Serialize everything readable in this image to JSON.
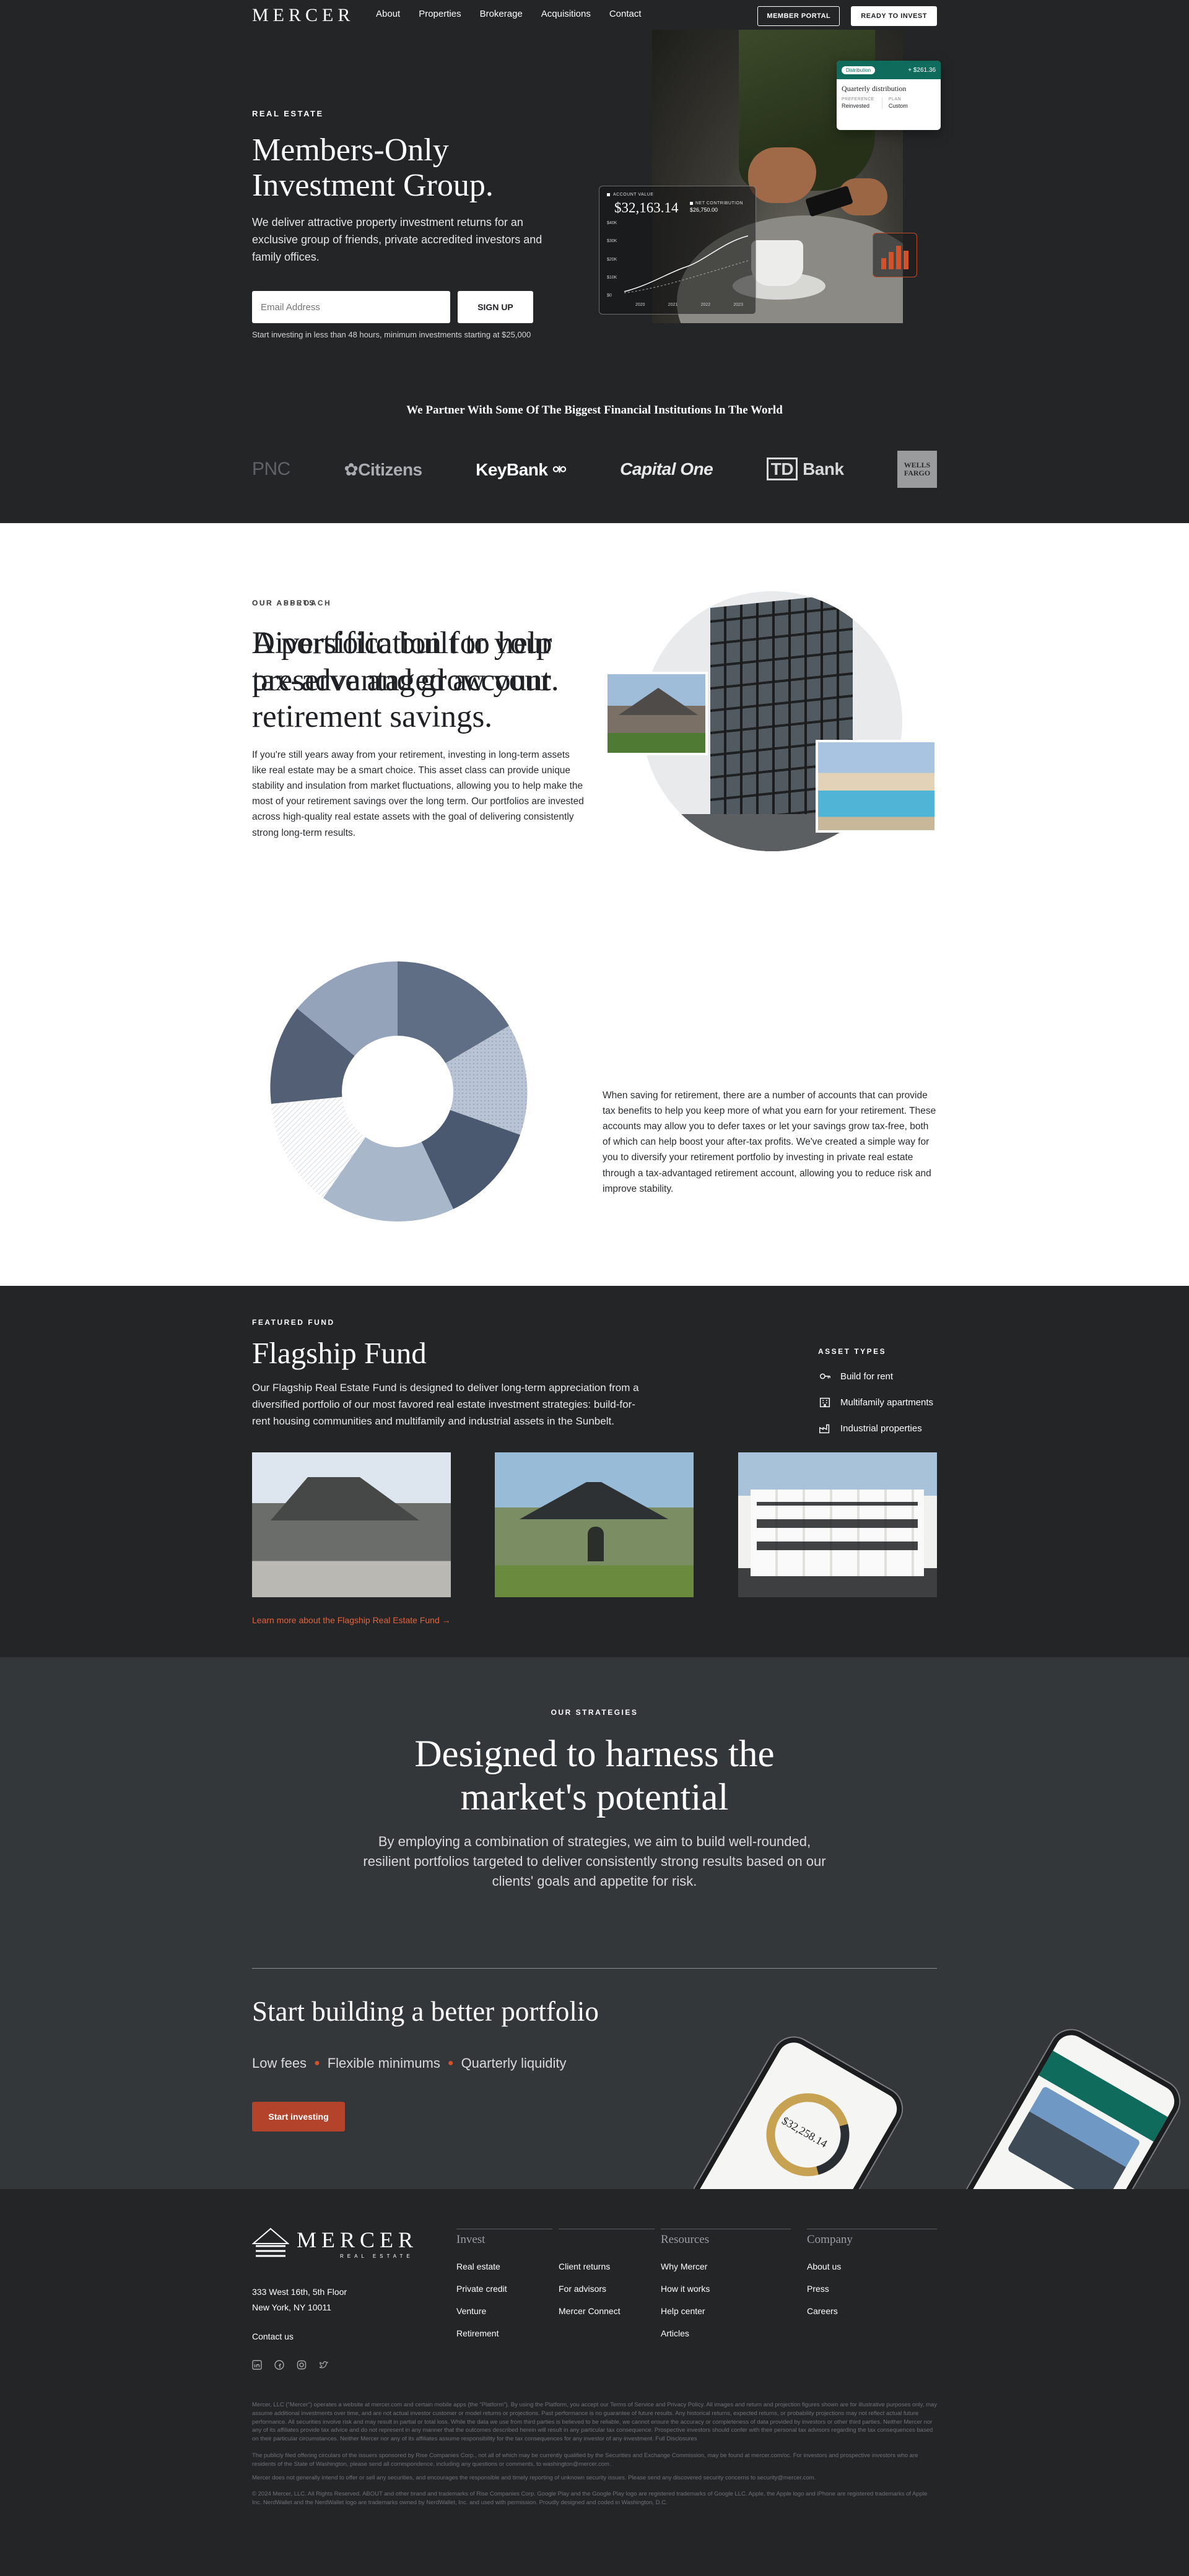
{
  "brand": "MERCER",
  "nav": {
    "links": [
      "About",
      "Properties",
      "Brokerage",
      "Acquisitions",
      "Contact"
    ],
    "member_portal": "MEMBER PORTAL",
    "ready": "READY TO INVEST"
  },
  "hero": {
    "eyebrow": "REAL ESTATE",
    "title": "Members-Only Investment Group.",
    "lead": "We deliver attractive property investment returns for an exclusive group of friends, private accredited investors and family offices.",
    "email_placeholder": "Email Address",
    "signup": "SIGN UP",
    "note": "Start investing in less than 48 hours, minimum investments starting at $25,000"
  },
  "dist_card": {
    "pill": "Distribution",
    "amount": "+ $261.36",
    "title": "Quarterly distribution",
    "k1": "PREFERENCE",
    "v1": "Reinvested",
    "k2": "PLAN",
    "v2": "Custom"
  },
  "acct_card": {
    "label": "ACCOUNT VALUE",
    "value": "$32,163.14",
    "net_label": "NET CONTRIBUTION",
    "net_value": "$26,750.00",
    "y_ticks": [
      "$40K",
      "$30K",
      "$20K",
      "$10K",
      "$0"
    ],
    "x_ticks": [
      "2020",
      "2021",
      "2022",
      "2023"
    ]
  },
  "partners": {
    "title": "We Partner With Some Of The Biggest Financial Institutions In The World",
    "logos": [
      "PNC",
      "Citizens",
      "KeyBank",
      "Capital One",
      "Bank",
      "WELLS FARGO"
    ]
  },
  "assets": {
    "eyebrow": "OUR ASSETS",
    "title": "A portfolio built to help preserve and grow your retirement savings.",
    "body": "If you're still years away from your retirement, investing in long-term assets like real estate may be a smart choice. This asset class can provide unique stability and insulation from market fluctuations, allowing you to help make the most of your retirement savings over the long term. Our portfolios are invested across high-quality real estate assets with the goal of delivering consistently strong long-term results."
  },
  "approach": {
    "eyebrow": "OUR APPROACH",
    "title": "Diversification for your tax-advantaged account.",
    "body": "When saving for retirement, there are a number of accounts that can provide tax benefits to help you keep more of what you earn for your retirement. These accounts may allow you to defer taxes or let your savings grow tax-free, both of which can help boost your after-tax profits. We've created a simple way for you to diversify your retirement portfolio by investing in private real estate through a tax-advantaged retirement account, allowing you to reduce risk and improve stability."
  },
  "flagship": {
    "eyebrow": "FEATURED FUND",
    "title": "Flagship Fund",
    "lead": "Our Flagship Real Estate Fund is designed to deliver long-term appreciation from a diversified portfolio of our most favored real estate investment strategies: build-for-rent housing communities and multifamily and industrial assets in the Sunbelt.",
    "types_title": "ASSET TYPES",
    "types": [
      "Build for rent",
      "Multifamily apartments",
      "Industrial properties"
    ],
    "more": "Learn more about the Flagship Real Estate Fund →"
  },
  "strategies": {
    "eyebrow": "OUR STRATEGIES",
    "title": "Designed to harness the market's potential",
    "lead": "By employing a combination of strategies, we aim to build well-rounded, resilient portfolios targeted to deliver consistently strong results based on our clients' goals and appetite for risk.",
    "build_title": "Start building a better portfolio",
    "features": [
      "Low fees",
      "Flexible minimums",
      "Quarterly liquidity"
    ],
    "cta": "Start investing",
    "phone_amount": "$32,258.14"
  },
  "footer": {
    "logo_sub": "REAL ESTATE",
    "address": [
      "333 West 16th, 5th Floor",
      "New York, NY 10011"
    ],
    "contact": "Contact us",
    "cols": [
      {
        "title": "Invest",
        "links": [
          "Real estate",
          "Private credit",
          "Venture",
          "Retirement"
        ]
      },
      {
        "title": "",
        "links": [
          "Client returns",
          "For advisors",
          "Mercer Connect"
        ]
      },
      {
        "title": "Resources",
        "links": [
          "Why Mercer",
          "How it works",
          "Help center",
          "Articles"
        ]
      },
      {
        "title": "Company",
        "links": [
          "About us",
          "Press",
          "Careers"
        ]
      }
    ],
    "fine1": "Mercer, LLC (\"Mercer\") operates a website at mercer.com and certain mobile apps (the \"Platform\"). By using the Platform, you accept our Terms of Service and Privacy Policy. All images and return and projection figures shown are for illustrative purposes only, may assume additional investments over time, and are not actual investor customer or model returns or projections. Past performance is no guarantee of future results. Any historical returns, expected returns, or probability projections may not reflect actual future performance. All securities involve risk and may result in partial or total loss. While the data we use from third parties is believed to be reliable, we cannot ensure the accuracy or completeness of data provided by investors or other third parties. Neither Mercer nor any of its affiliates provide tax advice and do not represent in any manner that the outcomes described herein will result in any particular tax consequence. Prospective investors should confer with their personal tax advisors regarding the tax consequences based on their particular circumstances. Neither Mercer nor any of its affiliates assume responsibility for the tax consequences for any investor of any investment. Full Disclosures",
    "fine2": "The publicly filed offering circulars of the issuers sponsored by Rise Companies Corp., not all of which may be currently qualified by the Securities and Exchange Commission, may be found at mercer.com/oc. For investors and prospective investors who are residents of the State of Washington, please send all correspondence, including any questions or comments, to washington@mercer.com.",
    "fine3": "Mercer does not generally intend to offer or sell any securities, and encourages the responsible and timely reporting of unknown security issues. Please send any discovered security concerns to security@mercer.com.",
    "fine4": "© 2024 Mercer, LLC. All Rights Reserved. ABOUT and other brand and trademarks of Rise Companies Corp. Google Play and the Google Play logo are registered trademarks of Google LLC. Apple, the Apple logo and iPhone are registered trademarks of Apple Inc. NerdWallet and the NerdWallet logo are trademarks owned by NerdWallet, Inc. and used with permission. Proudly designed and coded in Washington, D.C."
  },
  "colors": {
    "dark": "#232527",
    "dark2": "#34373a",
    "accent": "#b3432a",
    "teal": "#0f6b5c",
    "donut": "#a9b7cb"
  }
}
